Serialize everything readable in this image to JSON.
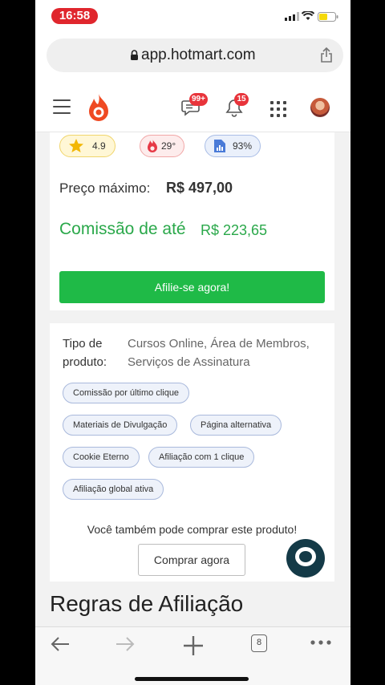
{
  "status_bar": {
    "time": "16:58"
  },
  "browser": {
    "url": "app.hotmart.com",
    "tab_count": "8"
  },
  "header": {
    "messages_badge": "99+",
    "notifications_badge": "15"
  },
  "product": {
    "chips": {
      "rating": "4.9",
      "temperature": "29°",
      "percentage": "93%"
    },
    "max_price_label": "Preço máximo:",
    "max_price_value": "R$ 497,00",
    "commission_label": "Comissão de até",
    "commission_value": "R$ 223,65",
    "affiliate_button": "Afilie-se agora!"
  },
  "details": {
    "type_label": "Tipo de produto:",
    "type_value": "Cursos Online, Área de Membros, Serviços de Assinatura",
    "tags": [
      "Comissão por último clique",
      "Materiais de Divulgação",
      "Página alternativa",
      "Cookie Eterno",
      "Afiliação com 1 clique",
      "Afiliação global ativa"
    ],
    "also_buy_text": "Você também pode comprar este produto!",
    "buy_button": "Comprar agora"
  },
  "section": {
    "title": "Regras de Afiliação"
  },
  "icons": [
    "signal-icon",
    "wifi-icon",
    "battery-icon",
    "lock-icon",
    "share-icon",
    "hamburger-icon",
    "hotmart-flame-logo",
    "messages-icon",
    "bell-icon",
    "apps-grid-icon",
    "star-icon",
    "flame-icon",
    "chart-icon",
    "chat-icon",
    "back-icon",
    "forward-icon",
    "new-tab-icon",
    "tabs-icon",
    "more-icon"
  ],
  "colors": {
    "accent_green": "#1fba47",
    "brand_red": "#e8343b",
    "commission_green": "#2aa84a"
  }
}
